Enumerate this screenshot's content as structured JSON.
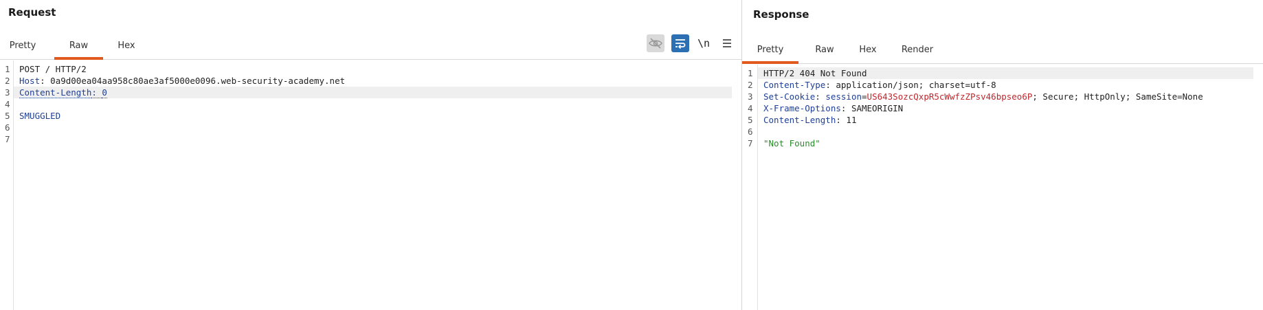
{
  "request": {
    "title": "Request",
    "tabs": [
      {
        "label": "Pretty",
        "active": false
      },
      {
        "label": "Raw",
        "active": true
      },
      {
        "label": "Hex",
        "active": false
      }
    ],
    "toolbar": {
      "hide_icon": "eye-slash-icon",
      "wrap_icon": "word-wrap-icon",
      "newline_label": "\\n",
      "menu_icon": "hamburger-menu-icon"
    },
    "lines": [
      {
        "n": "1",
        "text": "POST / HTTP/2"
      },
      {
        "n": "2",
        "key": "Host",
        "value": "0a9d00ea04aa958c80ae3af5000e0096.web-security-academy.net"
      },
      {
        "n": "3",
        "key": "Content-Length",
        "value": "0"
      },
      {
        "n": "4",
        "text": ""
      },
      {
        "n": "5",
        "text": "SMUGGLED"
      },
      {
        "n": "6",
        "text": ""
      },
      {
        "n": "7",
        "text": ""
      }
    ]
  },
  "response": {
    "title": "Response",
    "tabs": [
      {
        "label": "Pretty",
        "active": true
      },
      {
        "label": "Raw",
        "active": false
      },
      {
        "label": "Hex",
        "active": false
      },
      {
        "label": "Render",
        "active": false
      }
    ],
    "lines": [
      {
        "n": "1",
        "text": "HTTP/2 404 Not Found"
      },
      {
        "n": "2",
        "key": "Content-Type",
        "value": "application/json; charset=utf-8"
      },
      {
        "n": "3",
        "key": "Set-Cookie",
        "cookie_name": "session",
        "cookie_value": "US643SozcQxpR5cWwfzZPsv46bpseo6P",
        "rest": "; Secure; HttpOnly; SameSite=None"
      },
      {
        "n": "4",
        "key": "X-Frame-Options",
        "value": "SAMEORIGIN"
      },
      {
        "n": "5",
        "key": "Content-Length",
        "value": "11"
      },
      {
        "n": "6",
        "text": ""
      },
      {
        "n": "7",
        "text": "\"Not Found\""
      }
    ]
  },
  "colors": {
    "accent": "#e05a20",
    "header_key": "#1f3f95",
    "cookie_value": "#c0262d",
    "json_string": "#2a8a2a"
  }
}
